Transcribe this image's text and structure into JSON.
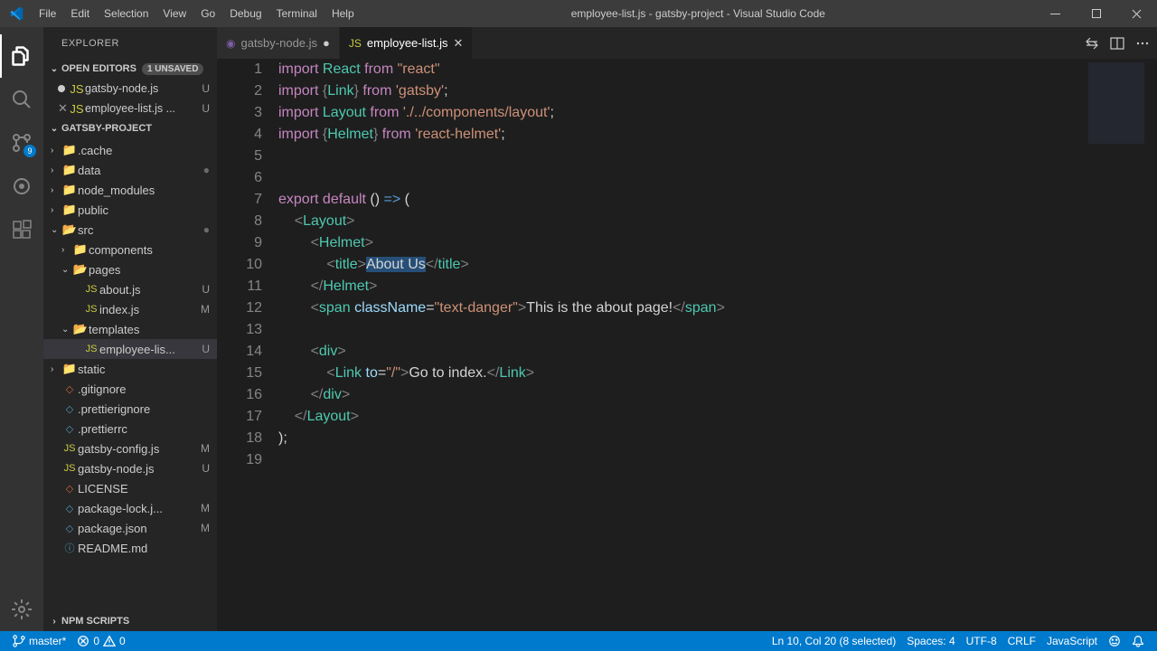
{
  "title_bar": {
    "menus": [
      "File",
      "Edit",
      "Selection",
      "View",
      "Go",
      "Debug",
      "Terminal",
      "Help"
    ],
    "title": "employee-list.js - gatsby-project - Visual Studio Code"
  },
  "activity": {
    "scm_badge": "9"
  },
  "sidebar": {
    "title": "EXPLORER",
    "open_editors": {
      "label": "OPEN EDITORS",
      "badge": "1 UNSAVED"
    },
    "editors": [
      {
        "name": "gatsby-node.js",
        "status": "U",
        "dirty": true
      },
      {
        "name": "employee-list.js ...",
        "status": "U",
        "dirty": false
      }
    ],
    "project": "GATSBY-PROJECT",
    "tree": [
      {
        "indent": 0,
        "twist": "›",
        "type": "folder",
        "name": ".cache",
        "status": ""
      },
      {
        "indent": 0,
        "twist": "›",
        "type": "folder",
        "name": "data",
        "status": "●"
      },
      {
        "indent": 0,
        "twist": "›",
        "type": "folder",
        "name": "node_modules",
        "status": ""
      },
      {
        "indent": 0,
        "twist": "›",
        "type": "folder",
        "name": "public",
        "status": ""
      },
      {
        "indent": 0,
        "twist": "⌄",
        "type": "folder-open",
        "name": "src",
        "status": "●"
      },
      {
        "indent": 1,
        "twist": "›",
        "type": "folder",
        "name": "components",
        "status": ""
      },
      {
        "indent": 1,
        "twist": "⌄",
        "type": "folder-open",
        "name": "pages",
        "status": ""
      },
      {
        "indent": 2,
        "twist": "",
        "type": "file-y",
        "name": "about.js",
        "status": "U"
      },
      {
        "indent": 2,
        "twist": "",
        "type": "file-y",
        "name": "index.js",
        "status": "M"
      },
      {
        "indent": 1,
        "twist": "⌄",
        "type": "folder-open",
        "name": "templates",
        "status": ""
      },
      {
        "indent": 2,
        "twist": "",
        "type": "file-y",
        "name": "employee-lis...",
        "status": "U",
        "selected": true
      },
      {
        "indent": 0,
        "twist": "›",
        "type": "folder",
        "name": "static",
        "status": ""
      },
      {
        "indent": 0,
        "twist": "",
        "type": "file-r",
        "name": ".gitignore",
        "status": ""
      },
      {
        "indent": 0,
        "twist": "",
        "type": "file",
        "name": ".prettierignore",
        "status": ""
      },
      {
        "indent": 0,
        "twist": "",
        "type": "file",
        "name": ".prettierrc",
        "status": ""
      },
      {
        "indent": 0,
        "twist": "",
        "type": "file-y",
        "name": "gatsby-config.js",
        "status": "M"
      },
      {
        "indent": 0,
        "twist": "",
        "type": "file-y",
        "name": "gatsby-node.js",
        "status": "U"
      },
      {
        "indent": 0,
        "twist": "",
        "type": "file-r",
        "name": "LICENSE",
        "status": ""
      },
      {
        "indent": 0,
        "twist": "",
        "type": "file",
        "name": "package-lock.j...",
        "status": "M"
      },
      {
        "indent": 0,
        "twist": "",
        "type": "file",
        "name": "package.json",
        "status": "M"
      },
      {
        "indent": 0,
        "twist": "",
        "type": "file-b",
        "name": "README.md",
        "status": ""
      }
    ],
    "npm_scripts": "NPM SCRIPTS"
  },
  "tabs": [
    {
      "name": "gatsby-node.js",
      "active": false,
      "dirty": true
    },
    {
      "name": "employee-list.js",
      "active": true,
      "dirty": false
    }
  ],
  "code_lines": 19,
  "status_bar": {
    "branch": "master*",
    "errors": "0",
    "warnings": "0",
    "cursor": "Ln 10, Col 20 (8 selected)",
    "spaces": "Spaces: 4",
    "encoding": "UTF-8",
    "eol": "CRLF",
    "language": "JavaScript"
  }
}
